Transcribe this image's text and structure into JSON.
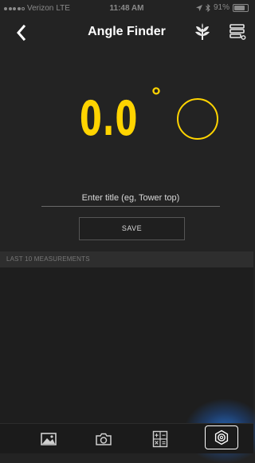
{
  "status_bar": {
    "carrier": "Verizon",
    "network": "LTE",
    "time": "11:48 AM",
    "battery_percent": "91%",
    "battery_level": 0.91
  },
  "nav": {
    "title": "Angle Finder",
    "back_icon": "chevron-left-icon",
    "plant_icon": "plant-icon",
    "menu_icon": "stack-menu-icon"
  },
  "measurement": {
    "angle": "0.0",
    "degree_symbol": "°",
    "accent_color": "#ffd400"
  },
  "form": {
    "title_placeholder": "Enter title (eg, Tower top)",
    "title_value": "",
    "save_label": "SAVE"
  },
  "history": {
    "header": "LAST 10 MEASUREMENTS",
    "items": []
  },
  "tabbar": {
    "tabs": [
      {
        "icon": "gallery-icon"
      },
      {
        "icon": "camera-icon"
      },
      {
        "icon": "calculator-icon"
      },
      {
        "icon": "settings-icon",
        "selected": true
      }
    ],
    "highlight_color": "#2878dc"
  }
}
